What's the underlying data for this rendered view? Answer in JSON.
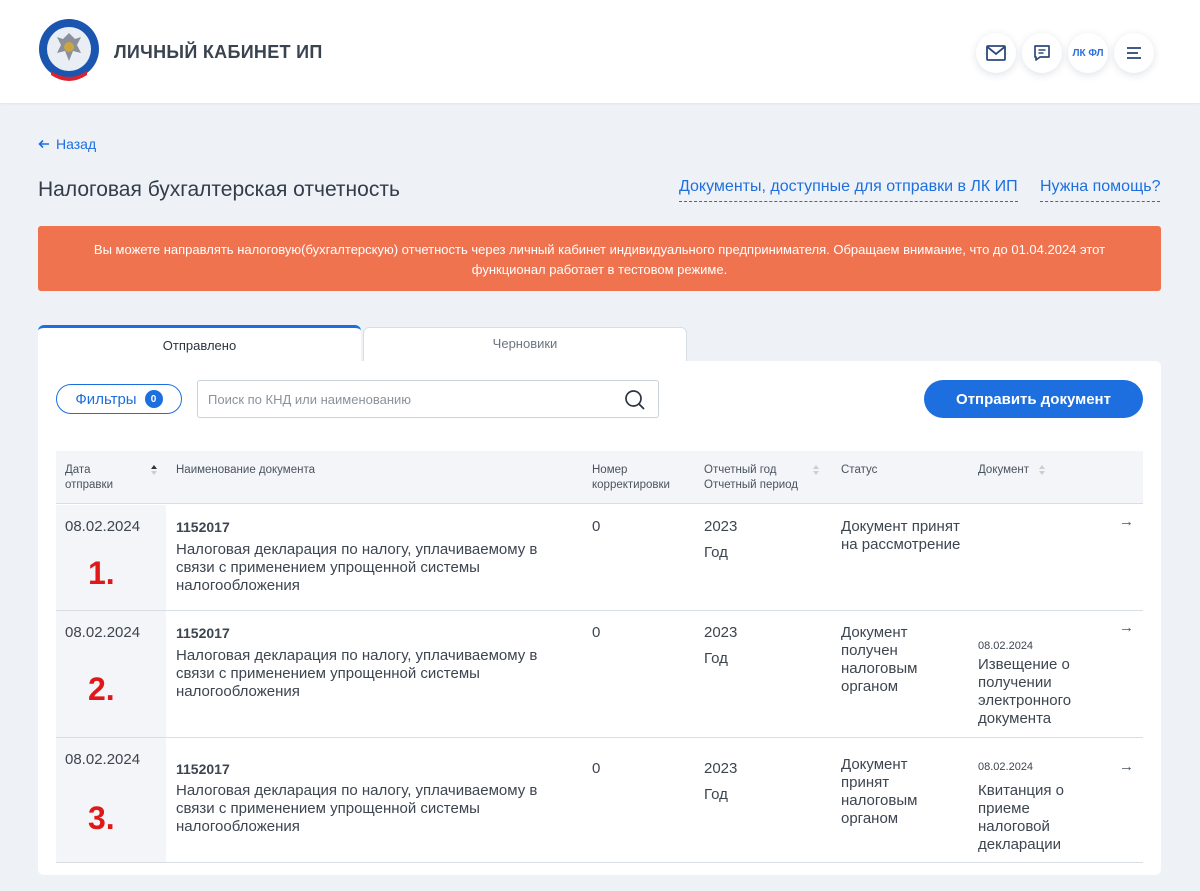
{
  "header": {
    "app_title": "ЛИЧНЫЙ КАБИНЕТ ИП",
    "lk_fl": "ЛК ФЛ",
    "icons": [
      "mail-icon",
      "chat-icon",
      "menu-icon"
    ]
  },
  "nav": {
    "back_label": "Назад"
  },
  "page": {
    "title": "Налоговая бухгалтерская отчетность",
    "docs_link": "Документы, доступные для отправки в ЛК ИП",
    "help_link": "Нужна помощь?"
  },
  "alert": {
    "text": "Вы можете направлять налоговую(бухгалтерскую) отчетность через личный кабинет индивидуального предпринимателя. Обращаем внимание, что до 01.04.2024 этот функционал работает в тестовом режиме.",
    "color": "#f07350"
  },
  "tabs": [
    {
      "label": "Отправлено",
      "active": true
    },
    {
      "label": "Черновики",
      "active": false
    }
  ],
  "toolbar": {
    "filters_label": "Фильтры",
    "filters_count": "0",
    "search_placeholder": "Поиск по КНД или наименованию",
    "send_label": "Отправить документ"
  },
  "table": {
    "headers": {
      "date_line1": "Дата",
      "date_line2": "отправки",
      "name": "Наименование документа",
      "corr_line1": "Номер",
      "corr_line2": "корректировки",
      "year_line1": "Отчетный год",
      "year_line2": "Отчетный период",
      "status": "Статус",
      "document": "Документ"
    },
    "rows": [
      {
        "date": "08.02.2024",
        "knd": "1152017",
        "name": "Налоговая декларация по налогу, уплачиваемому в связи с применением упрощенной системы налогообложения",
        "correction": "0",
        "year": "2023",
        "period": "Год",
        "status": "Документ принят на рассмотрение",
        "doc_date": "",
        "doc_name": "",
        "marker": "1."
      },
      {
        "date": "08.02.2024",
        "knd": "1152017",
        "name": "Налоговая декларация по налогу, уплачиваемому в связи с применением упрощенной системы налогообложения",
        "correction": "0",
        "year": "2023",
        "period": "Год",
        "status": "Документ получен налоговым органом",
        "doc_date": "08.02.2024",
        "doc_name": "Извещение о получении электронного документа",
        "marker": "2."
      },
      {
        "date": "08.02.2024",
        "knd": "1152017",
        "name": "Налоговая декларация по налогу, уплачиваемому в связи с применением упрощенной системы налогообложения",
        "correction": "0",
        "year": "2023",
        "period": "Год",
        "status": "Документ принят налоговым органом",
        "doc_date": "08.02.2024",
        "doc_name": "Квитанция о приеме налоговой декларации",
        "marker": "3."
      }
    ]
  },
  "colors": {
    "accent": "#1d6fe0",
    "marker": "#e01818"
  }
}
